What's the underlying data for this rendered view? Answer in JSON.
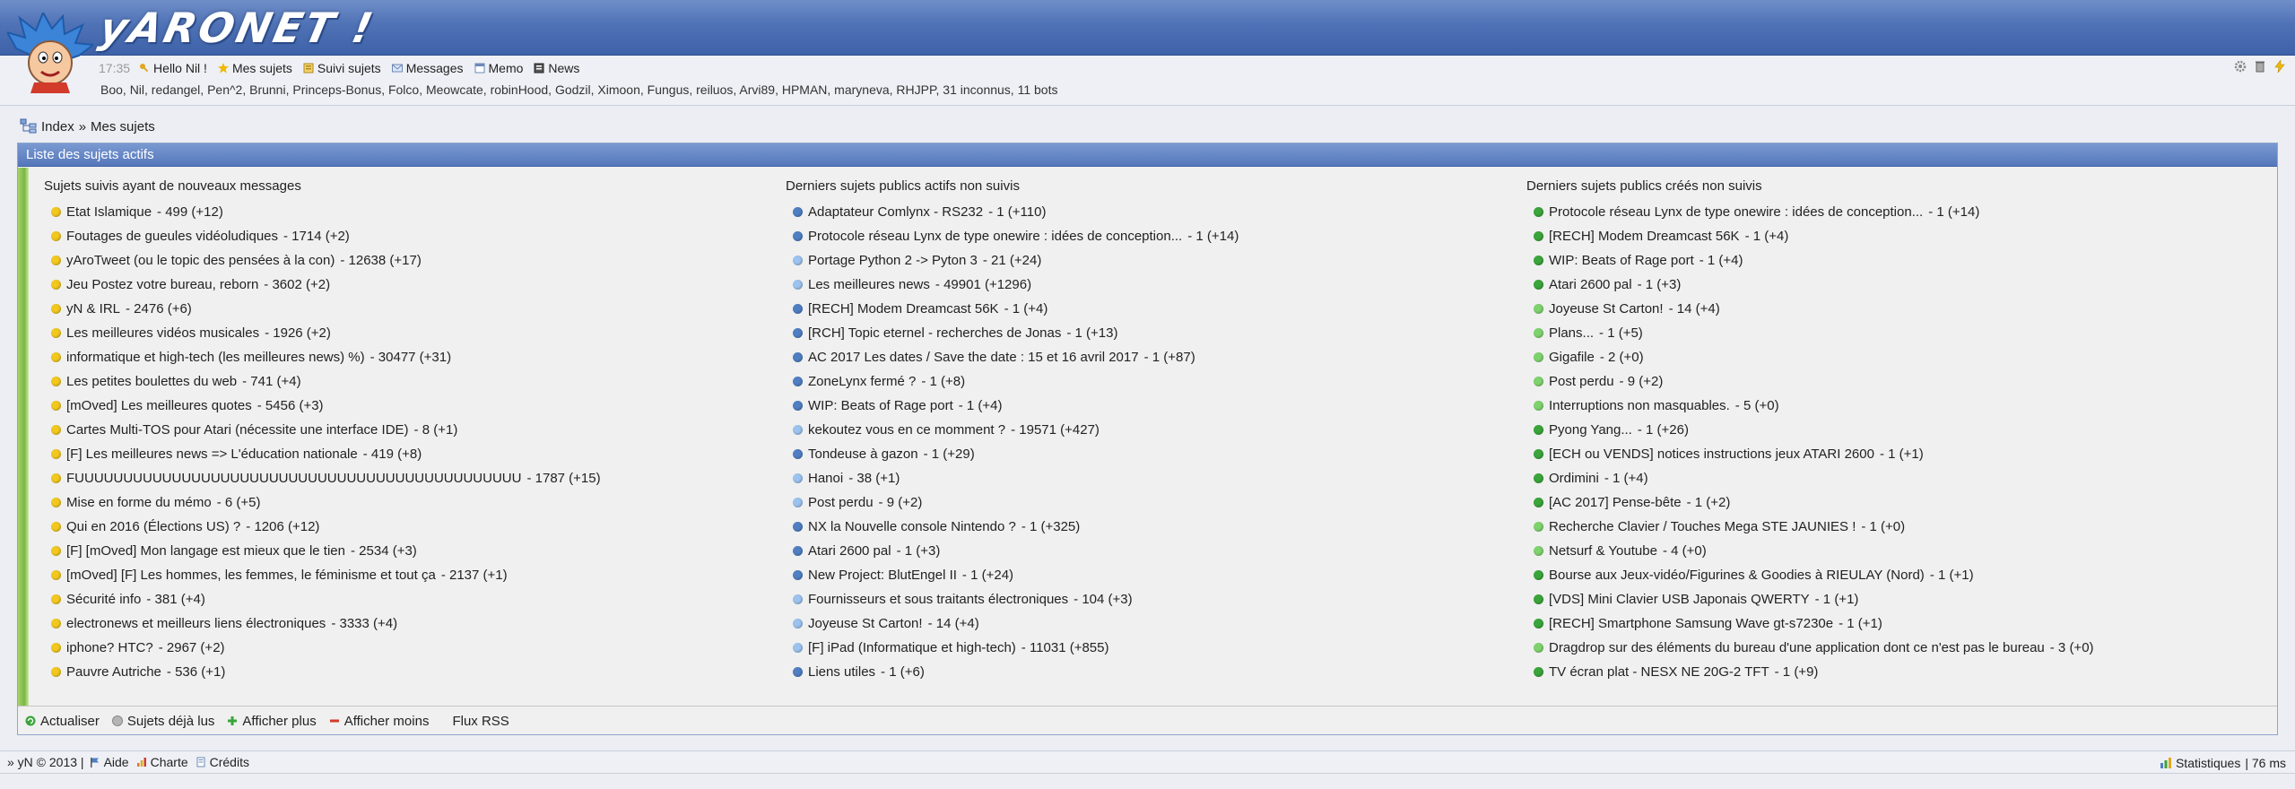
{
  "header": {
    "site_name": "yARONET !",
    "time": "17:35",
    "nav": [
      {
        "label": "Hello Nil !",
        "icon": "key-icon"
      },
      {
        "label": "Mes sujets",
        "icon": "star-icon"
      },
      {
        "label": "Suivi sujets",
        "icon": "bookmark-icon"
      },
      {
        "label": "Messages",
        "icon": "envelope-icon"
      },
      {
        "label": "Memo",
        "icon": "memo-icon"
      },
      {
        "label": "News",
        "icon": "news-icon"
      }
    ],
    "online_users": "Boo, Nil, redangel, Pen^2, Brunni, Princeps-Bonus, Folco, Meowcate, robinHood, Godzil, Ximoon, Fungus, reiluos, Arvi89, HPMAN, maryneva, RHJPP, 31 inconnus, 11 bots"
  },
  "breadcrumb": {
    "root": "Index",
    "separator": "»",
    "current": "Mes sujets"
  },
  "panel": {
    "title": "Liste des sujets actifs",
    "columns": [
      {
        "heading": "Sujets suivis ayant de nouveaux messages",
        "topics": [
          {
            "title": "Etat Islamique",
            "meta": "- 499 (+12)"
          },
          {
            "title": "Foutages de gueules vidéoludiques",
            "meta": "- 1714 (+2)"
          },
          {
            "title": "yAroTweet (ou le topic des pensées à la con)",
            "meta": "- 12638 (+17)"
          },
          {
            "title": "Jeu Postez votre bureau, reborn",
            "meta": "- 3602 (+2)"
          },
          {
            "title": "yN & IRL",
            "meta": "- 2476 (+6)"
          },
          {
            "title": "Les meilleures vidéos musicales",
            "meta": "- 1926 (+2)"
          },
          {
            "title": "informatique et high-tech (les meilleures news) %)",
            "meta": "- 30477 (+31)"
          },
          {
            "title": "Les petites boulettes du web",
            "meta": "- 741 (+4)"
          },
          {
            "title": "[mOved] Les meilleures quotes",
            "meta": "- 5456 (+3)"
          },
          {
            "title": "Cartes Multi-TOS pour Atari (nécessite une interface IDE)",
            "meta": "- 8 (+1)"
          },
          {
            "title": "[F] Les meilleures news => L'éducation nationale",
            "meta": "- 419 (+8)"
          },
          {
            "title": "FUUUUUUUUUUUUUUUUUUUUUUUUUUUUUUUUUUUUUUUUUUUUUU",
            "meta": "- 1787 (+15)"
          },
          {
            "title": "Mise en forme du mémo",
            "meta": "- 6 (+5)"
          },
          {
            "title": "Qui en 2016 (Élections US) ?",
            "meta": "- 1206 (+12)"
          },
          {
            "title": "[F] [mOved] Mon langage est mieux que le tien",
            "meta": "- 2534 (+3)"
          },
          {
            "title": "[mOved] [F] Les hommes, les femmes, le féminisme et tout ça",
            "meta": "- 2137 (+1)"
          },
          {
            "title": "Sécurité info",
            "meta": "- 381 (+4)"
          },
          {
            "title": "electronews et meilleurs liens électroniques",
            "meta": "- 3333 (+4)"
          },
          {
            "title": "iphone? HTC?",
            "meta": "- 2967 (+2)"
          },
          {
            "title": "Pauvre Autriche",
            "meta": "- 536 (+1)"
          }
        ]
      },
      {
        "heading": "Derniers sujets publics actifs non suivis",
        "topics": [
          {
            "title": "Adaptateur Comlynx - RS232",
            "meta": "- 1 (+110)"
          },
          {
            "title": "Protocole réseau Lynx de type onewire : idées de conception...",
            "meta": "- 1 (+14)"
          },
          {
            "title": "Portage Python 2 -> Pyton 3",
            "meta": "- 21 (+24)"
          },
          {
            "title": "Les meilleures news",
            "meta": "- 49901 (+1296)"
          },
          {
            "title": "[RECH] Modem Dreamcast 56K",
            "meta": "- 1 (+4)"
          },
          {
            "title": "[RCH] Topic eternel - recherches de Jonas",
            "meta": "- 1 (+13)"
          },
          {
            "title": "AC 2017 Les dates / Save the date : 15 et 16 avril 2017",
            "meta": "- 1 (+87)"
          },
          {
            "title": "ZoneLynx fermé ?",
            "meta": "- 1 (+8)"
          },
          {
            "title": "WIP: Beats of Rage port",
            "meta": "- 1 (+4)"
          },
          {
            "title": "kekoutez vous en ce momment ?",
            "meta": "- 19571 (+427)"
          },
          {
            "title": "Tondeuse à gazon",
            "meta": "- 1 (+29)"
          },
          {
            "title": "Hanoi",
            "meta": "- 38 (+1)"
          },
          {
            "title": "Post perdu",
            "meta": "- 9 (+2)"
          },
          {
            "title": "NX la Nouvelle console Nintendo ?",
            "meta": "- 1 (+325)"
          },
          {
            "title": "Atari 2600 pal",
            "meta": "- 1 (+3)"
          },
          {
            "title": "New Project: BlutEngel II",
            "meta": "- 1 (+24)"
          },
          {
            "title": "Fournisseurs et sous traitants électroniques",
            "meta": "- 104 (+3)"
          },
          {
            "title": "Joyeuse St Carton!",
            "meta": "- 14 (+4)"
          },
          {
            "title": "[F] iPad (Informatique et high-tech)",
            "meta": "- 11031 (+855)"
          },
          {
            "title": "Liens utiles",
            "meta": "- 1 (+6)"
          }
        ]
      },
      {
        "heading": "Derniers sujets publics créés non suivis",
        "topics": [
          {
            "title": "Protocole réseau Lynx de type onewire : idées de conception...",
            "meta": "- 1 (+14)"
          },
          {
            "title": "[RECH] Modem Dreamcast 56K",
            "meta": "- 1 (+4)"
          },
          {
            "title": "WIP: Beats of Rage port",
            "meta": "- 1 (+4)"
          },
          {
            "title": "Atari 2600 pal",
            "meta": "- 1 (+3)"
          },
          {
            "title": "Joyeuse St Carton!",
            "meta": "- 14 (+4)"
          },
          {
            "title": "Plans...",
            "meta": "- 1 (+5)"
          },
          {
            "title": "Gigafile",
            "meta": "- 2 (+0)"
          },
          {
            "title": "Post perdu",
            "meta": "- 9 (+2)"
          },
          {
            "title": "Interruptions non masquables.",
            "meta": "- 5 (+0)"
          },
          {
            "title": "Pyong Yang...",
            "meta": "- 1 (+26)"
          },
          {
            "title": "[ECH ou VENDS] notices instructions jeux ATARI 2600",
            "meta": "- 1 (+1)"
          },
          {
            "title": "Ordimini",
            "meta": "- 1 (+4)"
          },
          {
            "title": "[AC 2017] Pense-bête",
            "meta": "- 1 (+2)"
          },
          {
            "title": "Recherche Clavier / Touches Mega STE JAUNIES !",
            "meta": "- 1 (+0)"
          },
          {
            "title": "Netsurf & Youtube",
            "meta": "- 4 (+0)"
          },
          {
            "title": "Bourse aux Jeux-vidéo/Figurines & Goodies à RIEULAY (Nord)",
            "meta": "- 1 (+1)"
          },
          {
            "title": "[VDS] Mini Clavier USB Japonais QWERTY",
            "meta": "- 1 (+1)"
          },
          {
            "title": "[RECH] Smartphone Samsung Wave gt-s7230e",
            "meta": "- 1 (+1)"
          },
          {
            "title": "Dragdrop sur des éléments du bureau d'une application dont ce n'est pas le bureau",
            "meta": "- 3 (+0)"
          },
          {
            "title": "TV écran plat - NESX NE 20G-2 TFT",
            "meta": "- 1 (+9)"
          }
        ]
      }
    ],
    "actions": [
      {
        "label": "Actualiser",
        "icon": "refresh-icon"
      },
      {
        "label": "Sujets déjà lus",
        "icon": "read-topics-icon"
      },
      {
        "label": "Afficher plus",
        "icon": "plus-icon"
      },
      {
        "label": "Afficher moins",
        "icon": "minus-icon"
      },
      {
        "label": "Flux RSS",
        "icon": ""
      }
    ]
  },
  "footer": {
    "copyright": "» yN © 2013 |",
    "links": [
      {
        "label": "Aide",
        "icon": "flag-icon"
      },
      {
        "label": "Charte",
        "icon": "chart-icon"
      },
      {
        "label": "Crédits",
        "icon": "page-icon"
      }
    ],
    "stats_label": "Statistiques",
    "timing": "| 76 ms"
  },
  "colors": {
    "banner": "#4f72b6",
    "panel_title": "#5577bb",
    "bullet_yellow": "#f2c81e",
    "bullet_blue_dark": "#4f7fc2",
    "bullet_blue_light": "#9cc3ef",
    "bullet_green_dark": "#3aa53a",
    "bullet_green_light": "#7ed36e"
  }
}
